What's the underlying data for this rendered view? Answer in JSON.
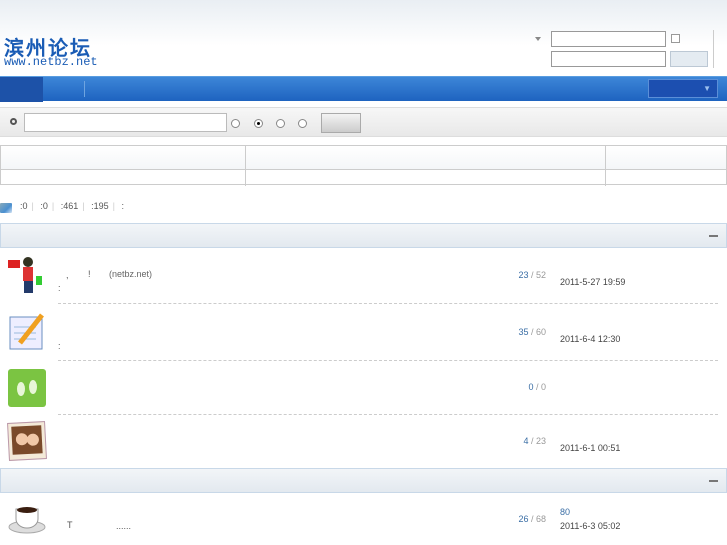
{
  "header": {
    "logo_text": "滨州论坛",
    "logo_url": "www.netbz.net"
  },
  "stats": {
    "values": [
      ":0",
      ":0",
      ":461",
      ":195",
      ":"
    ]
  },
  "forums": [
    {
      "icon": "megaphone-girl-icon",
      "desc_parts": [
        ",",
        "!",
        "(netbz.net)"
      ],
      "sub": ":",
      "threads": "23",
      "posts": "52",
      "last": "2011-5-27 19:59"
    },
    {
      "icon": "notepad-pencil-icon",
      "sub": ":",
      "threads": "35",
      "posts": "60",
      "last": "2011-6-4 12:30"
    },
    {
      "icon": "footprints-icon",
      "threads": "0",
      "posts": "0",
      "last": ""
    },
    {
      "icon": "photo-icon",
      "threads": "4",
      "posts": "23",
      "last": "2011-6-1 00:51"
    },
    {
      "icon": "coffee-cup-icon",
      "desc_parts": [
        "T",
        "......"
      ],
      "threads": "26",
      "posts": "68",
      "last_title": "80",
      "last": "2011-6-3 05:02"
    }
  ]
}
